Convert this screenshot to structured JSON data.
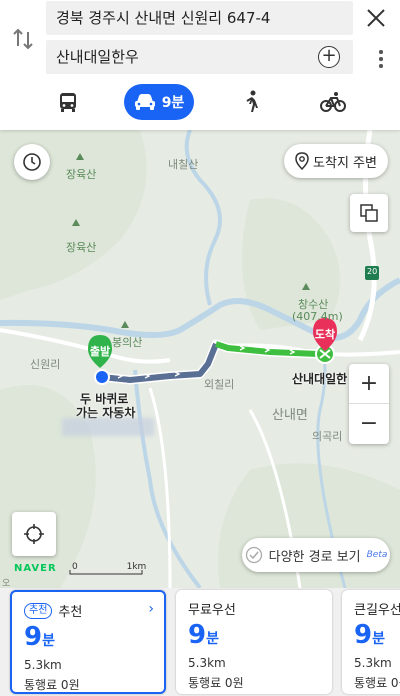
{
  "search": {
    "origin": "경북 경주시 산내면 신원리 647-4",
    "destination": "산내대일한우"
  },
  "modes": {
    "car_time": "9분"
  },
  "map": {
    "near_destination_label": "도착지 주변",
    "alt_routes_label": "다양한 경로 보기",
    "alt_routes_beta": "Beta",
    "brand": "NAVER",
    "scale_zero": "0",
    "scale_km": "1km",
    "zoom_in": "+",
    "zoom_out": "−",
    "start_badge": "출발",
    "end_badge": "도착",
    "start_label_line1": "두 바퀴로",
    "start_label_line2": "가는 자동차",
    "end_label": "산내대일한",
    "places": {
      "naeseul_san": "내칠산",
      "jangyuk_san": "장육산",
      "janggu_san": "장육산",
      "changsu_san": "창수산",
      "changsu_elev": "(407.4m)",
      "bongeui_san": "봉의산",
      "sinwon_ri": "신원리",
      "oechil_ri": "외칠리",
      "sannae_myeon": "산내면",
      "uigok_ri": "의곡리",
      "road_20": "20",
      "corner_o": "오"
    }
  },
  "route_color": "#5a6f94",
  "accent": "#1a64f5",
  "cards": [
    {
      "badge": "추천",
      "title": "추천",
      "time_num": "9",
      "time_unit": "분",
      "distance": "5.3km",
      "toll": "통행료 0원"
    },
    {
      "badge": "",
      "title": "무료우선",
      "time_num": "9",
      "time_unit": "분",
      "distance": "5.3km",
      "toll": "통행료 0원"
    },
    {
      "badge": "",
      "title": "큰길우선",
      "time_num": "9",
      "time_unit": "분",
      "distance": "5.3km",
      "toll": "통행료 0원"
    }
  ]
}
